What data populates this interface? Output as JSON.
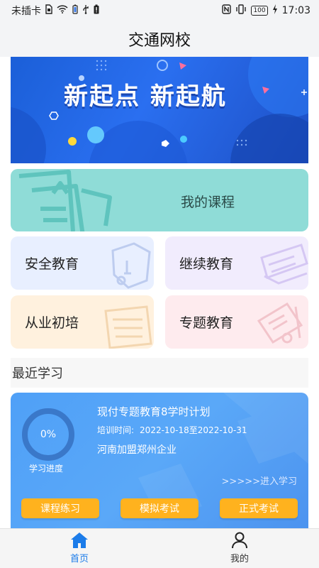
{
  "status_bar": {
    "carrier": "未插卡",
    "battery_level": "100",
    "time": "17:03"
  },
  "header": {
    "title": "交通网校"
  },
  "banner": {
    "title": "新起点  新起航"
  },
  "menu": {
    "my_courses": "我的课程",
    "safety_education": "安全教育",
    "continuing_education": "继续教育",
    "initial_training": "从业初培",
    "special_education": "专题教育"
  },
  "recent": {
    "section_title": "最近学习",
    "progress_percent": 0,
    "progress_text": "0%",
    "progress_label": "学习进度",
    "plan_title": "现付专题教育8学时计划",
    "time_label": "培训时间:",
    "time_range": "2022-10-18至2022-10-31",
    "organization": "河南加盟郑州企业",
    "enter_label": ">>>>>进入学习",
    "buttons": {
      "practice": "课程练习",
      "mock_exam": "模拟考试",
      "formal_exam": "正式考试"
    }
  },
  "tabbar": {
    "home": "首页",
    "mine": "我的"
  },
  "colors": {
    "accent": "#1c7ce9",
    "button": "#ffb21e",
    "teal_card": "#8fdcd7"
  },
  "icons": [
    "sim-icon",
    "wifi-icon",
    "usb-icon",
    "nfc-icon",
    "vibrate-icon",
    "charging-icon",
    "home-icon",
    "user-icon"
  ]
}
